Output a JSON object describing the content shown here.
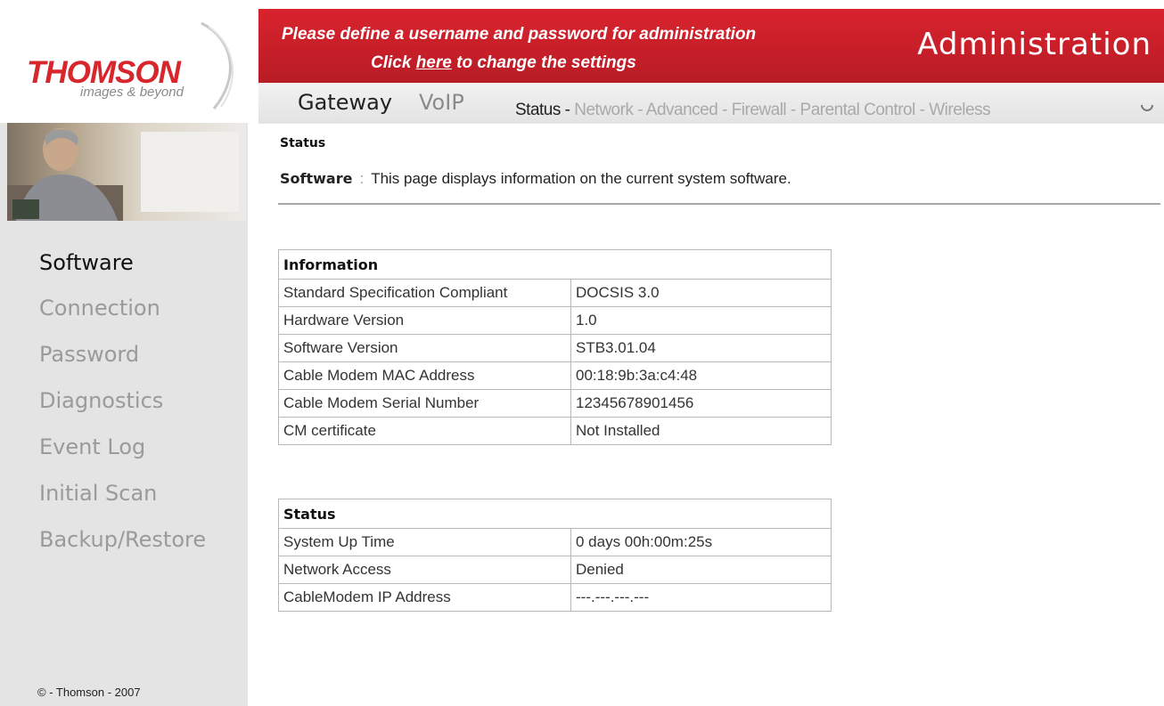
{
  "brand": {
    "name": "THOMSON",
    "tagline": "images & beyond"
  },
  "banner": {
    "line1": "Please define a username and password for administration",
    "line2_prefix": "Click ",
    "line2_link": "here",
    "line2_suffix": " to change the settings",
    "title": "Administration"
  },
  "nav": {
    "tabs": [
      {
        "label": "Gateway",
        "active": true
      },
      {
        "label": "VoIP",
        "active": false
      }
    ],
    "subnav": [
      "Status",
      "Network",
      "Advanced",
      "Firewall",
      "Parental Control",
      "Wireless"
    ],
    "separator": " - "
  },
  "sidebar": {
    "items": [
      {
        "label": "Software"
      },
      {
        "label": "Connection"
      },
      {
        "label": "Password"
      },
      {
        "label": "Diagnostics"
      },
      {
        "label": "Event Log"
      },
      {
        "label": "Initial Scan"
      },
      {
        "label": "Backup/Restore"
      }
    ],
    "copyright": "© - Thomson - 2007"
  },
  "page": {
    "title": "Status",
    "keyword": "Software",
    "colon": ":",
    "description": "This page displays information on the current system software."
  },
  "info_table": {
    "header": "Information",
    "rows": [
      {
        "label": "Standard Specification Compliant",
        "value": "DOCSIS 3.0"
      },
      {
        "label": "Hardware Version",
        "value": "1.0"
      },
      {
        "label": "Software Version",
        "value": "STB3.01.04"
      },
      {
        "label": "Cable Modem MAC Address",
        "value": "00:18:9b:3a:c4:48"
      },
      {
        "label": "Cable Modem Serial Number",
        "value": "12345678901456"
      },
      {
        "label": "CM certificate",
        "value": "Not Installed"
      }
    ]
  },
  "status_table": {
    "header": "Status",
    "rows": [
      {
        "label": "System Up Time",
        "value": "0 days 00h:00m:25s"
      },
      {
        "label": "Network Access",
        "value": "Denied"
      },
      {
        "label": "CableModem IP Address",
        "value": "---.---.---.---"
      }
    ]
  },
  "colors": {
    "brand_red": "#d9232e",
    "sidebar_bg": "#e4e4e4",
    "nav_bg": "#e8e8e8"
  }
}
